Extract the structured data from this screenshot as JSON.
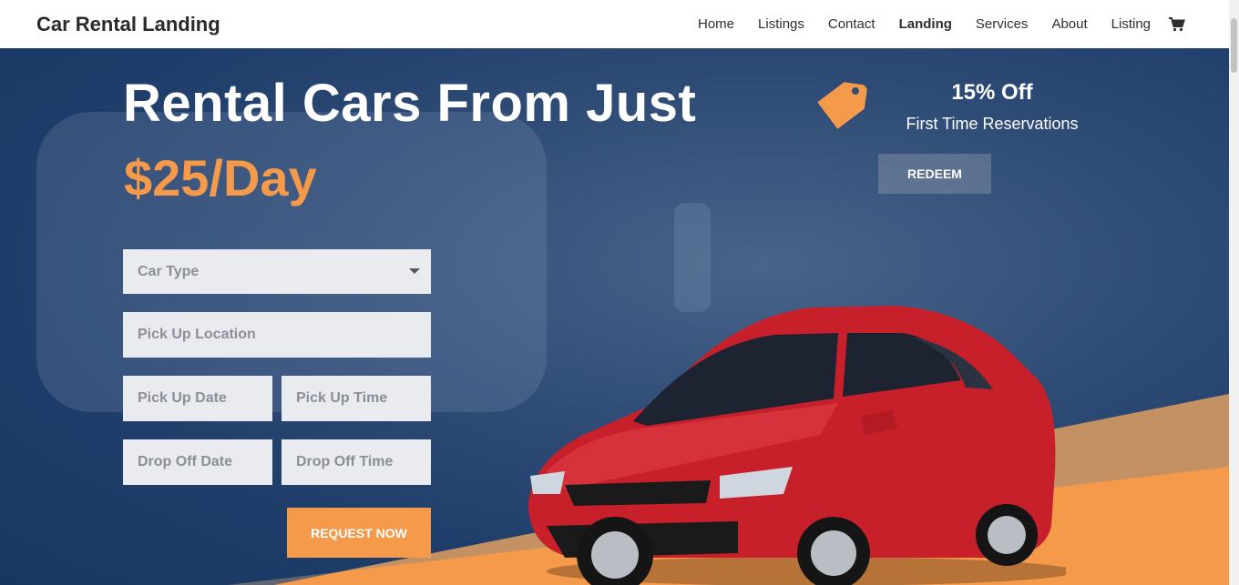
{
  "header": {
    "brand": "Car Rental Landing",
    "nav": [
      "Home",
      "Listings",
      "Contact",
      "Landing",
      "Services",
      "About",
      "Listing"
    ],
    "active_nav": "Landing",
    "cart_icon": "cart-icon"
  },
  "hero": {
    "headline": "Rental Cars From Just",
    "price": "$25/Day",
    "price_color": "#f59a4a"
  },
  "form": {
    "car_type_placeholder": "Car Type",
    "pickup_location_placeholder": "Pick Up Location",
    "pickup_date_placeholder": "Pick Up Date",
    "pickup_time_placeholder": "Pick Up Time",
    "dropoff_date_placeholder": "Drop Off Date",
    "dropoff_time_placeholder": "Drop Off Time",
    "submit_label": "REQUEST NOW"
  },
  "promo": {
    "title": "15% Off",
    "subtitle": "First Time Reservations",
    "button_label": "REDEEM",
    "tag_icon": "price-tag-icon"
  },
  "colors": {
    "accent": "#f59a4a",
    "hero_blue": "#1f3d6a",
    "car_red": "#c8202a"
  }
}
